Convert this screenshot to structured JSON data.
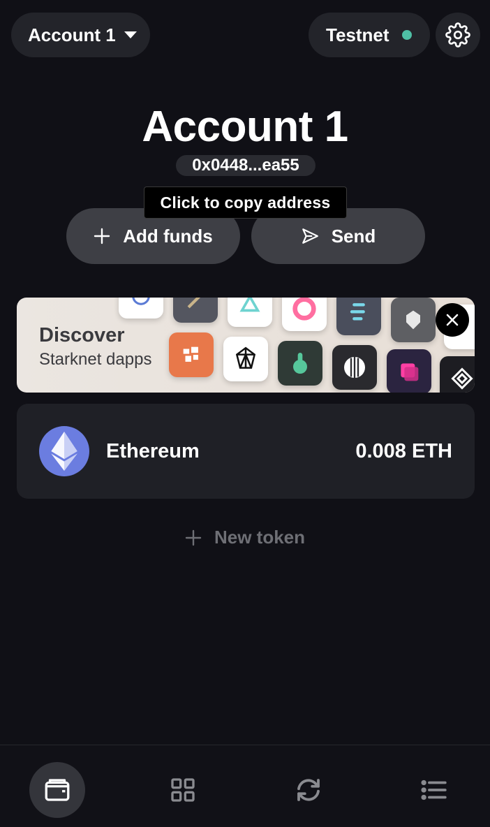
{
  "header": {
    "account_label": "Account 1",
    "network_label": "Testnet",
    "network_status_color": "#4fbfa5",
    "settings_icon": "gear-icon"
  },
  "account": {
    "title": "Account 1",
    "address_short": "0x0448...ea55",
    "tooltip": "Click to copy address"
  },
  "actions": {
    "add_funds_label": "Add funds",
    "send_label": "Send"
  },
  "discover": {
    "title": "Discover",
    "subtitle": "Starknet dapps"
  },
  "tokens": [
    {
      "name": "Ethereum",
      "balance": "0.008 ETH",
      "icon": "ethereum-icon",
      "icon_bg": "#6b7de0"
    }
  ],
  "new_token_label": "New token",
  "nav": [
    {
      "name": "wallet",
      "icon": "wallet-icon",
      "active": true
    },
    {
      "name": "apps",
      "icon": "grid-icon",
      "active": false
    },
    {
      "name": "swap",
      "icon": "swap-icon",
      "active": false
    },
    {
      "name": "activity",
      "icon": "list-icon",
      "active": false
    }
  ],
  "colors": {
    "background": "#101016",
    "surface": "#23242a",
    "button": "#3e3f45",
    "muted_text": "#6e6f75"
  }
}
